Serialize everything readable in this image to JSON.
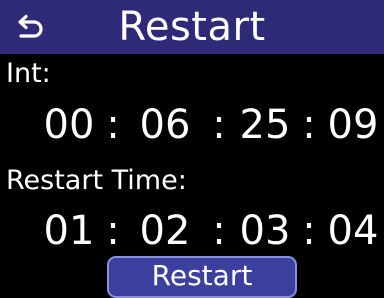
{
  "header": {
    "title": "Restart",
    "back_icon": "return-arrow-icon",
    "background_color": "#2f2a78"
  },
  "int": {
    "label": "Int:",
    "hours": "00",
    "minutes": "06",
    "seconds": "25",
    "frames": "09",
    "separator": ":"
  },
  "restart_time": {
    "label": "Restart Time:",
    "hours": "01",
    "minutes": "02",
    "seconds": "03",
    "frames": "04",
    "separator": ":"
  },
  "restart_button": {
    "label": "Restart",
    "background_color": "#3b3f9e"
  }
}
